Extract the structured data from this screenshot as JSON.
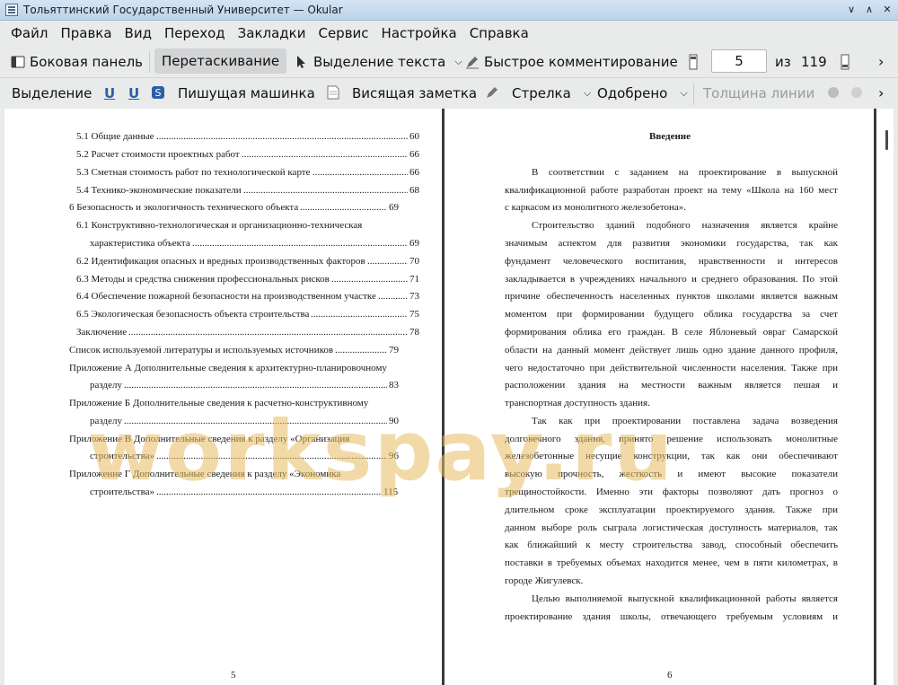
{
  "window": {
    "title": "Тольяттинский Государственный Университет  — Okular",
    "controls": [
      "∨",
      "∧",
      "✕"
    ]
  },
  "menu": [
    "Файл",
    "Правка",
    "Вид",
    "Переход",
    "Закладки",
    "Сервис",
    "Настройка",
    "Справка"
  ],
  "toolbar1": {
    "sidebar": "Боковая панель",
    "drag": "Перетаскивание",
    "text_select": "Выделение текста",
    "quick_comment": "Быстрое комментирование",
    "page_current": "5",
    "page_of": "из",
    "page_total": "119",
    "more": "›"
  },
  "toolbar2": {
    "highlight": "Выделение",
    "typewriter": "Пишущая машинка",
    "note": "Висящая заметка",
    "arrow": "Стрелка",
    "approved": "Одобрено",
    "line_width": "Толщина линии",
    "more": "›"
  },
  "left_page": {
    "number": "5",
    "toc": [
      {
        "text": "5.1 Общие данные",
        "page": "60"
      },
      {
        "text": "5.2 Расчет стоимости проектных работ",
        "page": "66"
      },
      {
        "text": "5.3 Сметная стоимость работ по технологической карте",
        "page": "66"
      },
      {
        "text": "5.4 Технико-экономические показатели",
        "page": "68"
      },
      {
        "text": "6 Безопасность и экологичность технического объекта",
        "page": "69"
      },
      {
        "text": "6.1 Конструктивно-технологическая и организационно-техническая",
        "page": ""
      },
      {
        "text": "характеристика объекта",
        "page": "69"
      },
      {
        "text": "6.2 Идентификация опасных и вредных производственных факторов",
        "page": "70"
      },
      {
        "text": "6.3 Методы и средства снижения профессиональных рисков",
        "page": "71"
      },
      {
        "text": "6.4 Обеспечение пожарной безопасности на производственном участке",
        "page": "73"
      },
      {
        "text": "6.5 Экологическая безопасность объекта строительства",
        "page": "75"
      },
      {
        "text": "Заключение",
        "page": "78"
      },
      {
        "text": "Список используемой литературы и используемых источников",
        "page": "79"
      },
      {
        "text": "Приложение А Дополнительные сведения к архитектурно-планировочному",
        "page": ""
      },
      {
        "text": "разделу",
        "page": "83"
      },
      {
        "text": "Приложение Б Дополнительные сведения к расчетно-конструктивному",
        "page": ""
      },
      {
        "text": "разделу",
        "page": "90"
      },
      {
        "text": "Приложение В Дополнительные сведения к разделу «Организация",
        "page": ""
      },
      {
        "text": "строительства»",
        "page": "96"
      },
      {
        "text": "Приложение Г Дополнительные сведения к разделу «Экономика",
        "page": ""
      },
      {
        "text": "строительства»",
        "page": "115"
      }
    ]
  },
  "right_page": {
    "number": "6",
    "heading": "Введение",
    "lines": [
      "В соответствии с заданием на проектирование в выпускной",
      "квалификационной работе разработан проект на тему «Школа на 160 мест",
      "с каркасом из монолитного железобетона».",
      "Строительство зданий подобного назначения является крайне",
      "значимым аспектом для развития экономики государства, так как",
      "фундамент человеческого воспитания, нравственности и интересов",
      "закладывается в учреждениях начального и среднего образования.  По этой",
      "причине обеспеченность населенных пунктов школами является важным",
      "моментом при формировании будущего облика государства за счет",
      "формирования облика его граждан. В селе Яблоневый овраг Самарской",
      "области на данный момент действует лишь одно здание данного профиля,",
      "чего недостаточно при действительной численности населения. Также при",
      "расположении здания на местности важным является пешая и",
      "транспортная доступность здания.",
      "Так как при проектировании поставлена задача возведения",
      "долговечного здания, принято решение использовать монолитные",
      "железобетонные несущие конструкции, так как они обеспечивают",
      "высокую прочность, жесткость и имеют высокие показатели",
      "трещиностойкости. Именно эти факторы позволяют дать прогноз о",
      "длительном сроке эксплуатации проектируемого здания. Также при",
      "данном выборе роль сыграла логистическая доступность материалов, так",
      "как ближайший к месту строительства завод, способный обеспечить",
      "поставки в требуемых объемах находится менее, чем в пяти километрах, в",
      "городе Жигулевск.",
      "Целью выполняемой выпускной квалификационной работы является",
      "проектирование здания школы, отвечающего требуемым условиям и"
    ]
  },
  "watermark": "workspay.ru",
  "colors": {
    "titlebar": "#c9dcef",
    "toolbar": "#e9eaea",
    "watermark": "#e8bc60"
  }
}
